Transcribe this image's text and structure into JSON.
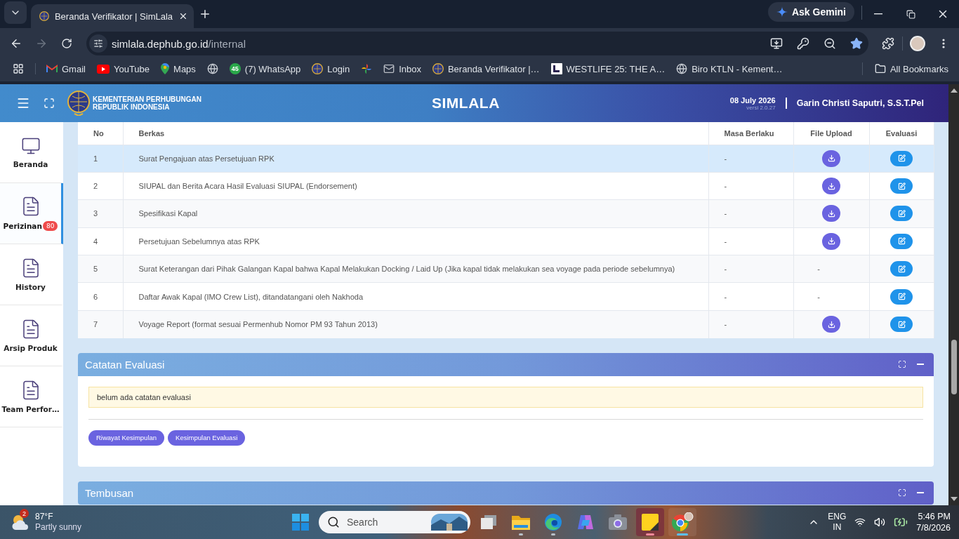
{
  "browser": {
    "tab_title": "Beranda Verifikator | SimLala",
    "url_host": "simlala.dephub.go.id",
    "url_path": "/internal",
    "ask_gemini": "Ask Gemini",
    "all_bookmarks": "All Bookmarks",
    "bookmarks": [
      {
        "kind": "gmail",
        "label": "Gmail"
      },
      {
        "kind": "youtube",
        "label": "YouTube"
      },
      {
        "kind": "maps",
        "label": "Maps"
      },
      {
        "kind": "globe"
      },
      {
        "kind": "whatsapp",
        "badge": "45",
        "label": "(7) WhatsApp"
      },
      {
        "kind": "emblem",
        "label": "Login"
      },
      {
        "kind": "photos"
      },
      {
        "kind": "inbox",
        "label": "Inbox"
      },
      {
        "kind": "emblem",
        "label": "Beranda Verifikator |…"
      },
      {
        "kind": "tile",
        "label": "WESTLIFE 25: THE A…"
      },
      {
        "kind": "globe",
        "label": "Biro KTLN - Kement…"
      }
    ]
  },
  "app": {
    "org_line1": "KEMENTERIAN PERHUBUNGAN",
    "org_line2": "REPUBLIK INDONESIA",
    "title": "SIMLALA",
    "date": "08 July 2026",
    "version": "versi 2.0.27",
    "user": "Garin Christi Saputri, S.S.T.Pel"
  },
  "sidebar": [
    {
      "kind": "monitor",
      "label": "Beranda",
      "selected": false
    },
    {
      "kind": "document",
      "label": "Perizinan",
      "badge": "80",
      "selected": true
    },
    {
      "kind": "document",
      "label": "History",
      "selected": false
    },
    {
      "kind": "document",
      "label": "Arsip Produk",
      "selected": false
    },
    {
      "kind": "document",
      "label": "Team Perfor…",
      "selected": false
    }
  ],
  "table": {
    "columns": [
      "No",
      "Berkas",
      "Masa Berlaku",
      "File Upload",
      "Evaluasi"
    ],
    "rows": [
      {
        "no": "1",
        "berkas": "Surat Pengajuan atas Persetujuan RPK",
        "masa_berlaku": "-",
        "file_upload": {
          "kind": "download"
        },
        "selected": true
      },
      {
        "no": "2",
        "berkas": "SIUPAL dan Berita Acara Hasil Evaluasi SIUPAL (Endorsement)",
        "masa_berlaku": "-",
        "file_upload": {
          "kind": "download"
        },
        "selected": false
      },
      {
        "no": "3",
        "berkas": "Spesifikasi Kapal",
        "masa_berlaku": "-",
        "file_upload": {
          "kind": "download"
        },
        "selected": false
      },
      {
        "no": "4",
        "berkas": "Persetujuan Sebelumnya atas RPK",
        "masa_berlaku": "-",
        "file_upload": {
          "kind": "download"
        },
        "selected": false
      },
      {
        "no": "5",
        "berkas": "Surat Keterangan dari Pihak Galangan Kapal bahwa Kapal Melakukan Docking / Laid Up (Jika kapal tidak melakukan sea voyage pada periode sebelumnya)",
        "masa_berlaku": "-",
        "file_upload": {
          "kind": "text",
          "text": "-"
        },
        "selected": false
      },
      {
        "no": "6",
        "berkas": "Daftar Awak Kapal (IMO Crew List), ditandatangani oleh Nakhoda",
        "masa_berlaku": "-",
        "file_upload": {
          "kind": "text",
          "text": "-"
        },
        "selected": false
      },
      {
        "no": "7",
        "berkas": "Voyage Report (format sesuai Permenhub Nomor PM 93 Tahun 2013)",
        "masa_berlaku": "-",
        "file_upload": {
          "kind": "download"
        },
        "selected": false
      }
    ]
  },
  "catatan": {
    "title": "Catatan Evaluasi",
    "note": "belum ada catatan evaluasi",
    "buttons": [
      "Riwayat Kesimpulan",
      "Kesimpulan Evaluasi"
    ]
  },
  "tembusan": {
    "title": "Tembusan"
  },
  "taskbar": {
    "weather": {
      "badge": "2",
      "temp": "87°F",
      "condition": "Partly sunny"
    },
    "search_placeholder": "Search",
    "apps": [
      {
        "kind": "task-view",
        "running": false,
        "selected": false,
        "attention": false
      },
      {
        "kind": "explorer",
        "running": true,
        "selected": false,
        "attention": false
      },
      {
        "kind": "edge",
        "running": true,
        "selected": false,
        "attention": false
      },
      {
        "kind": "copilot",
        "running": false,
        "selected": false,
        "attention": false
      },
      {
        "kind": "camera",
        "running": false,
        "selected": false,
        "attention": false
      },
      {
        "kind": "sticky-notes",
        "running": true,
        "selected": false,
        "attention": true
      },
      {
        "kind": "chrome",
        "running": true,
        "selected": true,
        "attention": false
      }
    ],
    "lang": [
      "ENG",
      "IN"
    ],
    "time": "5:46 PM",
    "date": "7/8/2026"
  }
}
